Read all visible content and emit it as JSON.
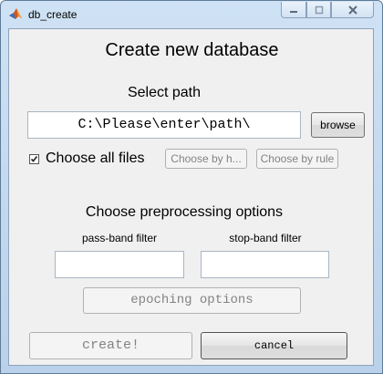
{
  "window": {
    "title": "db_create"
  },
  "main": {
    "heading": "Create new database",
    "select_path_label": "Select path",
    "path_value": "C:\\Please\\enter\\path\\",
    "browse_label": "browse",
    "choose_all_label": "Choose all files",
    "choose_all_checked": true,
    "choose_by_h_label": "Choose by h...",
    "choose_by_rule_label": "Choose by rule",
    "preprocessing_label": "Choose preprocessing options",
    "pass_band_label": "pass-band filter",
    "stop_band_label": "stop-band filter",
    "pass_band_value": "",
    "stop_band_value": "",
    "epoching_label": "epoching options",
    "create_label": "create!",
    "cancel_label": "cancel"
  },
  "colors": {
    "titlebar": "#cfe2f5",
    "client": "#f0f0f0",
    "disabled_text": "#838383"
  },
  "icons": {
    "app": "matlab-icon",
    "minimize": "minimize-icon",
    "maximize": "maximize-icon",
    "close": "close-icon",
    "check": "checkmark-icon"
  }
}
